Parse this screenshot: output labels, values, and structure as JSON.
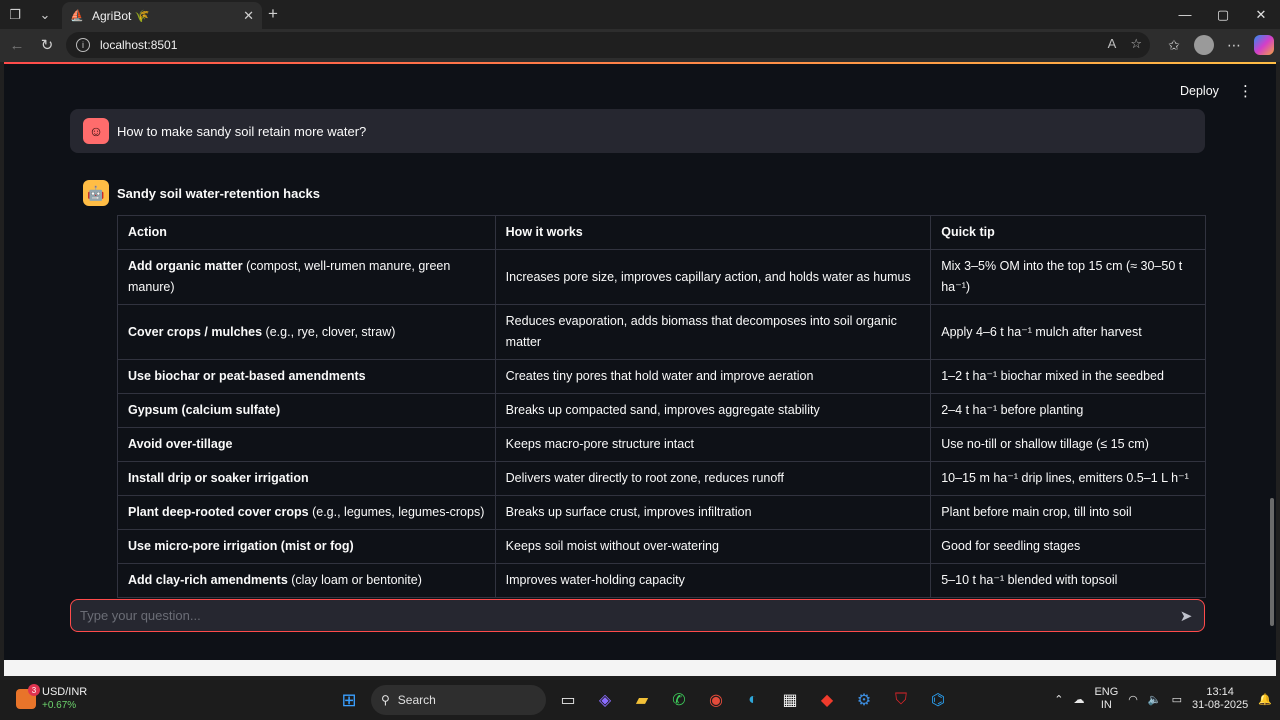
{
  "browser": {
    "tab_title": "AgriBot 🌾",
    "url": "localhost:8501"
  },
  "app": {
    "deploy_label": "Deploy",
    "user_question": "How to make sandy soil retain more water?",
    "bot_heading": "Sandy soil water-retention hacks",
    "table": {
      "headers": [
        "Action",
        "How it works",
        "Quick tip"
      ],
      "rows": [
        {
          "action_bold": "Add organic matter",
          "action_rest": " (compost, well-rumen manure, green manure)",
          "how": "Increases pore size, improves capillary action, and holds water as humus",
          "tip": "Mix 3–5% OM into the top 15 cm (≈ 30–50 t ha⁻¹)"
        },
        {
          "action_bold": "Cover crops / mulches",
          "action_rest": " (e.g., rye, clover, straw)",
          "how": "Reduces evaporation, adds biomass that decomposes into soil organic matter",
          "tip": "Apply 4–6 t ha⁻¹ mulch after harvest"
        },
        {
          "action_bold": "Use biochar or peat-based amendments",
          "action_rest": "",
          "how": "Creates tiny pores that hold water and improve aeration",
          "tip": "1–2 t ha⁻¹ biochar mixed in the seedbed"
        },
        {
          "action_bold": "Gypsum (calcium sulfate)",
          "action_rest": "",
          "how": "Breaks up compacted sand, improves aggregate stability",
          "tip": "2–4 t ha⁻¹ before planting"
        },
        {
          "action_bold": "Avoid over-tillage",
          "action_rest": "",
          "how": "Keeps macro-pore structure intact",
          "tip": "Use no-till or shallow tillage (≤ 15 cm)"
        },
        {
          "action_bold": "Install drip or soaker irrigation",
          "action_rest": "",
          "how": "Delivers water directly to root zone, reduces runoff",
          "tip": "10–15 m ha⁻¹ drip lines, emitters 0.5–1 L h⁻¹"
        },
        {
          "action_bold": "Plant deep-rooted cover crops",
          "action_rest": " (e.g., legumes, legumes-crops)",
          "how": "Breaks up surface crust, improves infiltration",
          "tip": "Plant before main crop, till into soil"
        },
        {
          "action_bold": "Use micro-pore irrigation (mist or fog)",
          "action_rest": "",
          "how": "Keeps soil moist without over-watering",
          "tip": "Good for seedling stages"
        },
        {
          "action_bold": "Add clay-rich amendments",
          "action_rest": " (clay loam or bentonite)",
          "how": "Improves water-holding capacity",
          "tip": "5–10 t ha⁻¹ blended with topsoil"
        }
      ]
    },
    "input_placeholder": "Type your question...",
    "accent": "#ff4b4b"
  },
  "taskbar": {
    "ticker_name": "USD/INR",
    "ticker_change": "+0.67%",
    "ticker_badge": "3",
    "search_label": "Search",
    "lang": "ENG",
    "region": "IN",
    "time": "13:14",
    "date": "31-08-2025"
  }
}
